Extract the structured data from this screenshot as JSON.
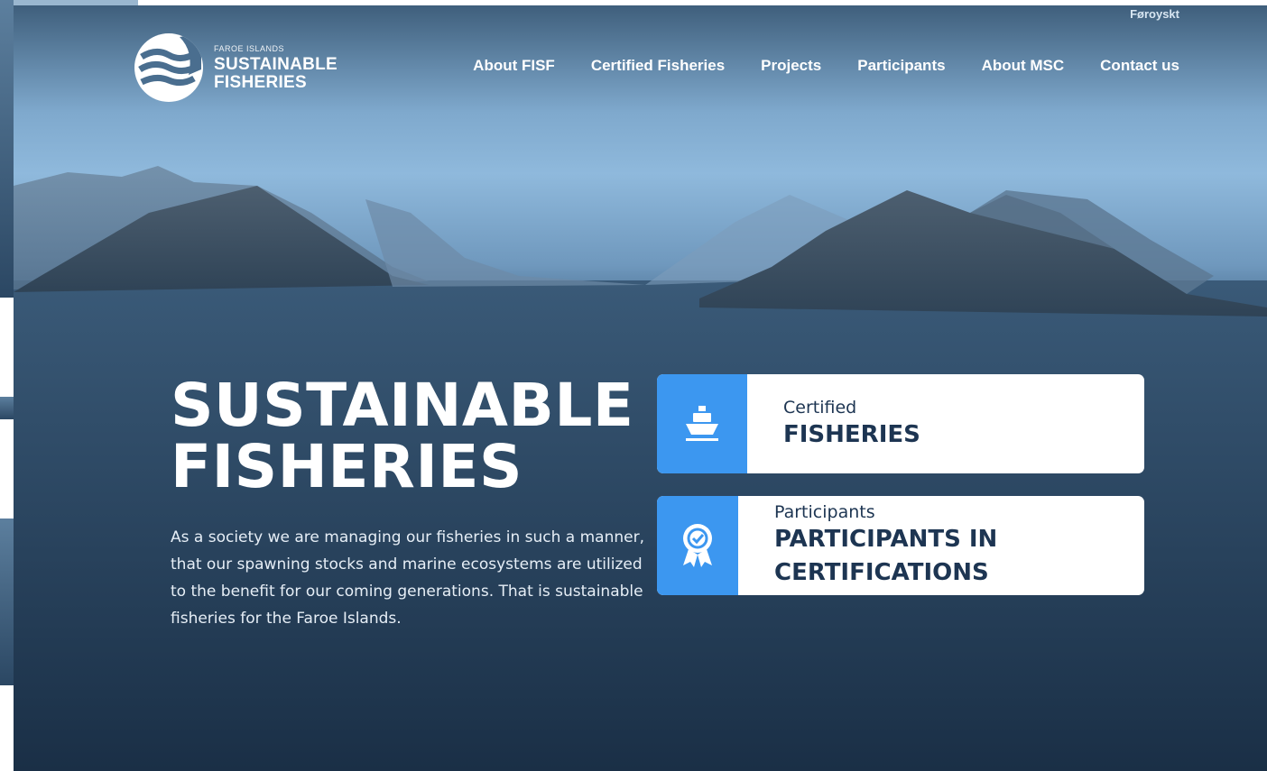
{
  "header": {
    "logo": {
      "small": "FAROE ISLANDS",
      "line1": "SUSTAINABLE",
      "line2": "FISHERIES"
    },
    "language": "Føroyskt",
    "nav": [
      "About FISF",
      "Certified Fisheries",
      "Projects",
      "Participants",
      "About MSC",
      "Contact us"
    ]
  },
  "hero": {
    "title_line1": "SUSTAINABLE",
    "title_line2": "FISHERIES",
    "text": "As a society we are managing our fisheries in such a manner, that our spawning stocks and marine ecosystems are utilized to the benefit for our coming generations. That is sustainable fisheries for the Faroe Islands."
  },
  "cards": [
    {
      "small": "Certified",
      "big": "FISHERIES",
      "icon": "ship-icon"
    },
    {
      "small": "Participants",
      "big": "PARTICIPANTS IN CERTIFICATIONS",
      "icon": "award-ribbon-icon"
    }
  ],
  "colors": {
    "accent": "#3c97f0",
    "card_text": "#1d3552"
  }
}
